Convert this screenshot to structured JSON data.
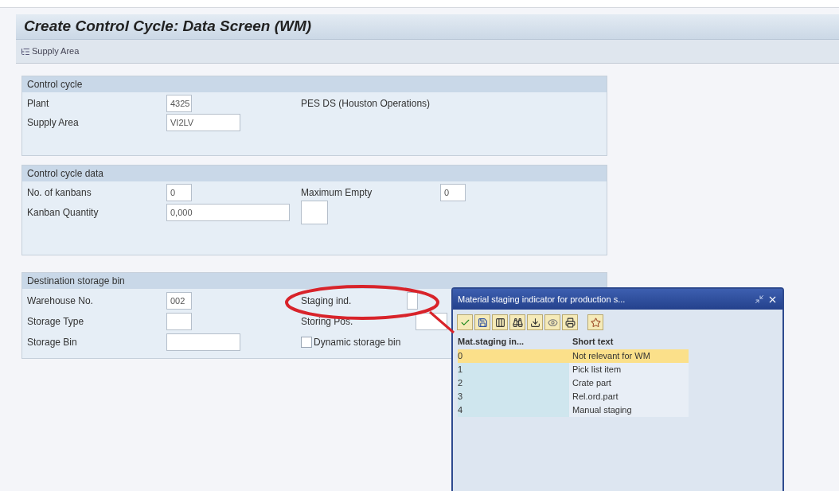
{
  "title": "Create Control Cycle: Data Screen (WM)",
  "toolbar": {
    "label": "Supply Area"
  },
  "control_cycle": {
    "title": "Control cycle",
    "plant": {
      "label": "Plant",
      "value": "4325",
      "description": "PES DS (Houston Operations)"
    },
    "supply_area": {
      "label": "Supply Area",
      "value": "VI2LV"
    }
  },
  "control_cycle_data": {
    "title": "Control cycle data",
    "kanbans": {
      "label": "No. of kanbans",
      "value": "0"
    },
    "max_empty": {
      "label": "Maximum Empty",
      "value": "0"
    },
    "kanban_quantity": {
      "label": "Kanban Quantity",
      "value": "0,000"
    }
  },
  "destination": {
    "title": "Destination storage bin",
    "warehouse": {
      "label": "Warehouse No.",
      "value": "002"
    },
    "staging_ind": {
      "label": "Staging ind."
    },
    "storage_type": {
      "label": "Storage Type"
    },
    "storing_pos": {
      "label": "Storing Pos."
    },
    "storage_bin": {
      "label": "Storage Bin"
    },
    "dynamic_bin": {
      "label": "Dynamic storage bin",
      "checked": false
    }
  },
  "popup": {
    "title": "Material staging indicator for production s...",
    "columns": [
      "Mat.staging in...",
      "Short text"
    ],
    "rows": [
      {
        "code": "0",
        "text": "Not relevant for WM",
        "selected": true
      },
      {
        "code": "1",
        "text": "Pick list item",
        "selected": false
      },
      {
        "code": "2",
        "text": "Crate part",
        "selected": false
      },
      {
        "code": "3",
        "text": "Rel.ord.part",
        "selected": false
      },
      {
        "code": "4",
        "text": "Manual staging",
        "selected": false
      }
    ]
  }
}
